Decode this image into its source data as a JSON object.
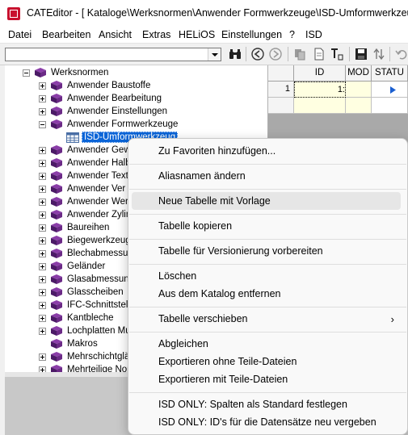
{
  "window": {
    "title": "CATEditor - [ Kataloge\\Werksnormen\\Anwender Formwerkzeuge\\ISD-Umformwerkzeug ]"
  },
  "menubar": [
    "Datei",
    "Bearbeiten",
    "Ansicht",
    "Extras",
    "HELiOS",
    "Einstellungen",
    "?",
    "ISD"
  ],
  "toolbar": {
    "combo_value": "",
    "icons": [
      "binoculars-icon",
      "back-icon",
      "forward-icon",
      "copy-icon",
      "document-icon",
      "text-format-icon",
      "save-icon",
      "sort-icon",
      "undo-icon"
    ]
  },
  "tree": {
    "root": "Werksnormen",
    "items": [
      {
        "label": "Anwender Baustoffe"
      },
      {
        "label": "Anwender Bearbeitung"
      },
      {
        "label": "Anwender Einstellungen"
      },
      {
        "label": "Anwender Formwerkzeuge"
      },
      {
        "label": "ISD-Umformwerkzeug"
      },
      {
        "label": "Anwender Gew"
      },
      {
        "label": "Anwender Halb"
      },
      {
        "label": "Anwender Text"
      },
      {
        "label": "Anwender Ver"
      },
      {
        "label": "Anwender Wer"
      },
      {
        "label": "Anwender Zylin"
      },
      {
        "label": "Baureihen"
      },
      {
        "label": "Biegewerkzeug"
      },
      {
        "label": "Blechabmessu"
      },
      {
        "label": "Geländer"
      },
      {
        "label": "Glasabmessung"
      },
      {
        "label": "Glasscheiben"
      },
      {
        "label": "IFC-Schnittstell"
      },
      {
        "label": "Kantbleche"
      },
      {
        "label": "Lochplatten Mu"
      },
      {
        "label": "Makros"
      },
      {
        "label": "Mehrschichtglä"
      },
      {
        "label": "Mehrteilige Norn"
      }
    ]
  },
  "grid": {
    "headers": [
      "ID",
      "MOD",
      "STATU"
    ],
    "rows": [
      {
        "num": "1",
        "id": "1:"
      }
    ]
  },
  "context_menu": {
    "items": [
      {
        "label": "Zu Favoriten hinzufügen..."
      },
      {
        "label": "Aliasnamen ändern"
      },
      {
        "label": "Neue Tabelle mit Vorlage"
      },
      {
        "label": "Tabelle kopieren"
      },
      {
        "label": "Tabelle für Versionierung vorbereiten"
      },
      {
        "label": "Löschen"
      },
      {
        "label": "Aus dem Katalog entfernen"
      },
      {
        "label": "Tabelle verschieben"
      },
      {
        "label": "Abgleichen"
      },
      {
        "label": "Exportieren ohne Teile-Dateien"
      },
      {
        "label": "Exportieren mit Teile-Dateien"
      },
      {
        "label": "ISD ONLY: Spalten als Standard festlegen"
      },
      {
        "label": "ISD ONLY: ID's für die Datensätze neu vergeben"
      }
    ]
  },
  "colors": {
    "selection": "#0a64d7",
    "book": "#6b2a86",
    "cell_yellow": "#ffffe1",
    "menu_hover": "#e6e6e6"
  }
}
